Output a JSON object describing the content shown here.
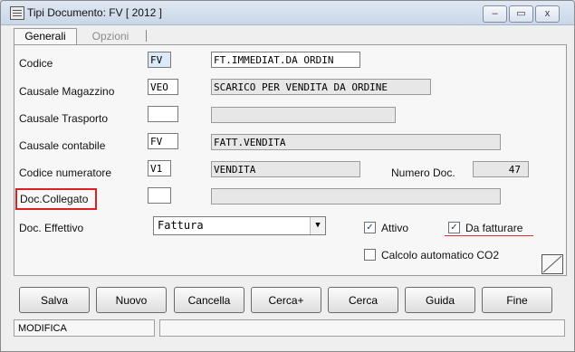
{
  "window": {
    "title": "Tipi Documento: FV [ 2012 ]",
    "minimize_glyph": "–",
    "restore_glyph": "▭",
    "close_glyph": "x"
  },
  "tabs": [
    {
      "label": "Generali",
      "active": true
    },
    {
      "label": "Opzioni",
      "active": false
    }
  ],
  "form": {
    "codice": {
      "label": "Codice",
      "code": "FV",
      "description": "FT.IMMEDIAT.DA ORDIN"
    },
    "causale_magazzino": {
      "label": "Causale Magazzino",
      "code": "VEO",
      "description": "SCARICO PER VENDITA DA ORDINE"
    },
    "causale_trasporto": {
      "label": "Causale Trasporto",
      "code": "",
      "description": ""
    },
    "causale_contabile": {
      "label": "Causale contabile",
      "code": "FV",
      "description": "FATT.VENDITA"
    },
    "codice_numeratore": {
      "label": "Codice numeratore",
      "code": "V1",
      "description": "VENDITA"
    },
    "numero_doc": {
      "label": "Numero Doc.",
      "value": "47"
    },
    "doc_collegato": {
      "label": "Doc.Collegato",
      "code": "",
      "description": ""
    },
    "doc_effettivo": {
      "label": "Doc. Effettivo",
      "selected": "Fattura"
    },
    "attivo": {
      "label": "Attivo",
      "checked": true,
      "mark": "✓"
    },
    "da_fatturare": {
      "label": "Da fatturare",
      "checked": true,
      "mark": "✓"
    },
    "calcolo_co2": {
      "label": "Calcolo automatico CO2",
      "checked": false,
      "mark": ""
    }
  },
  "buttons": {
    "salva": "Salva",
    "nuovo": "Nuovo",
    "cancella": "Cancella",
    "cerca_plus": "Cerca+",
    "cerca": "Cerca",
    "guida": "Guida",
    "fine": "Fine"
  },
  "status": {
    "mode": "MODIFICA",
    "message": ""
  },
  "colors": {
    "highlight": "#e02020",
    "field_blue": "#dbe9f8"
  }
}
